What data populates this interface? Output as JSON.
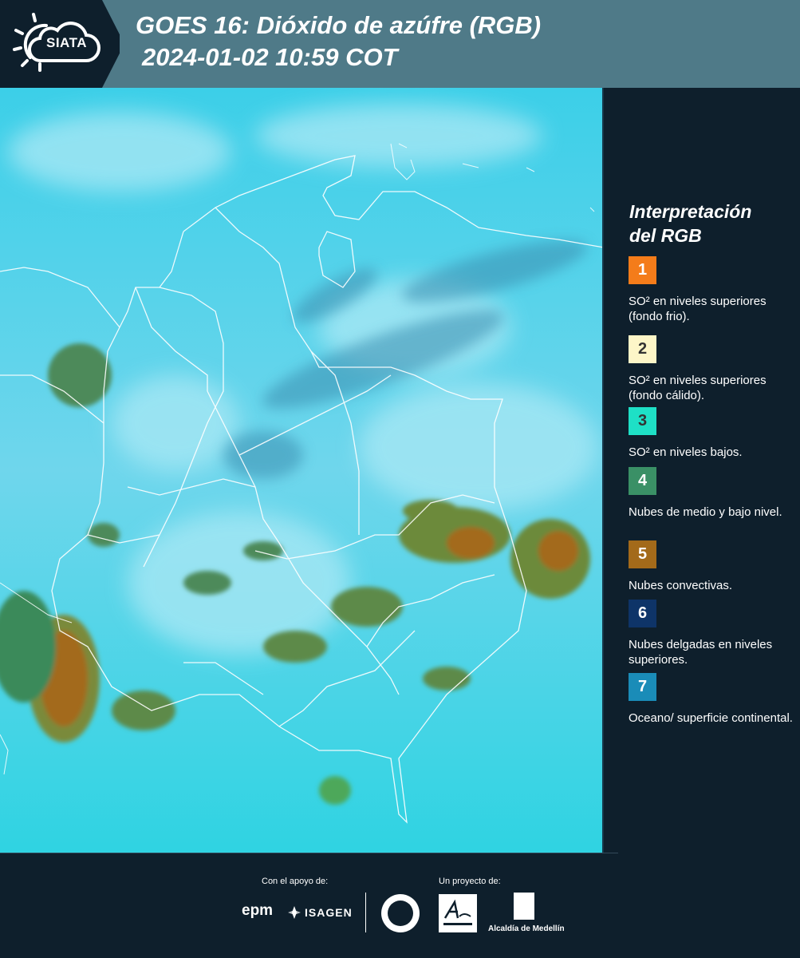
{
  "header": {
    "logo_text": "SIATA",
    "title_line1": "GOES 16: Dióxido de azúfre (RGB)",
    "title_line2": "2024-01-02 10:59 COT"
  },
  "legend": {
    "title_line1": "Interpretación",
    "title_line2": "del RGB",
    "items": [
      {
        "number": "1",
        "color": "#f47c1a",
        "label": "SO² en niveles superiores (fondo frio)."
      },
      {
        "number": "2",
        "color": "#fdf6c8",
        "label": "SO² en niveles superiores (fondo cálido)."
      },
      {
        "number": "3",
        "color": "#1ee0c6",
        "label": "SO² en niveles bajos."
      },
      {
        "number": "4",
        "color": "#3a9066",
        "label": "Nubes de medio y bajo nivel."
      },
      {
        "number": "5",
        "color": "#a36a1a",
        "label": "Nubes convectivas."
      },
      {
        "number": "6",
        "color": "#0e3468",
        "label": "Nubes delgadas en niveles superiores."
      },
      {
        "number": "7",
        "color": "#1a8cb8",
        "label": "Oceano/ superficie continental."
      }
    ]
  },
  "footer": {
    "support_label": "Con el apoyo de:",
    "project_label": "Un proyecto de:",
    "epm": "epm",
    "isagen": "ISAGEN",
    "alcaldia": "Alcaldía de Medellín"
  }
}
